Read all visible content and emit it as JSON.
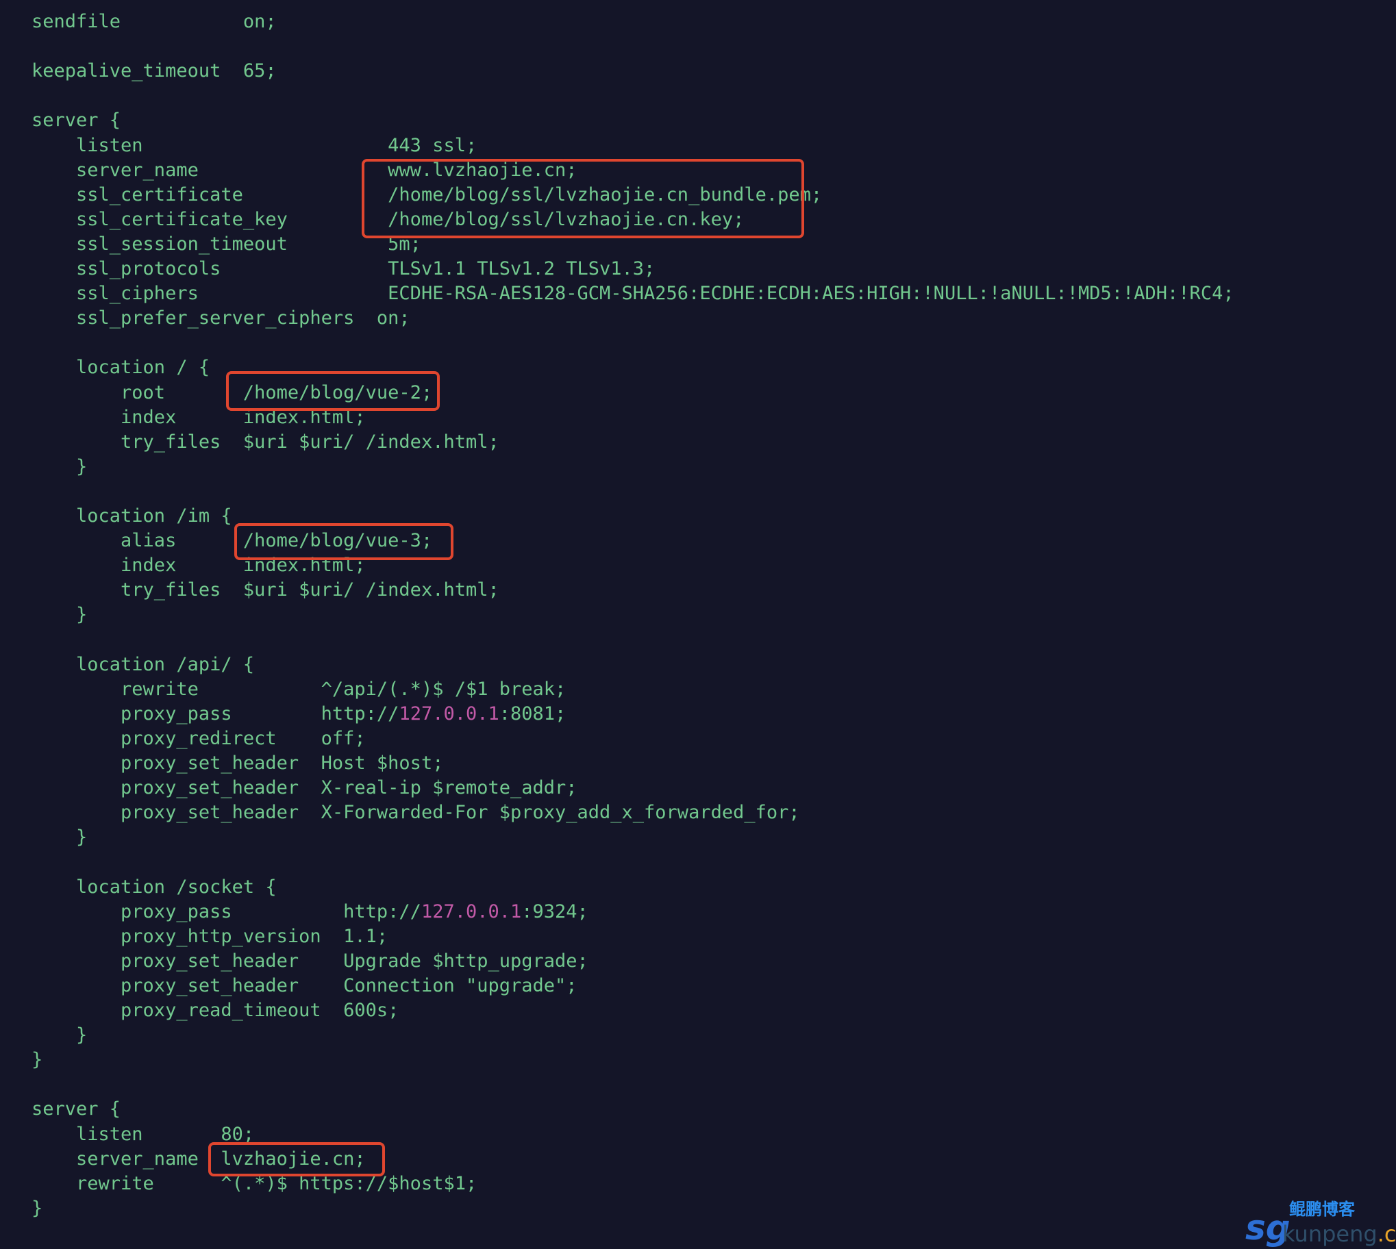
{
  "code": {
    "lines": [
      "sendfile           on;",
      "",
      "keepalive_timeout  65;",
      "",
      "server {",
      "    listen                      443 ssl;",
      "    server_name                 www.lvzhaojie.cn;",
      "    ssl_certificate             /home/blog/ssl/lvzhaojie.cn_bundle.pem;",
      "    ssl_certificate_key         /home/blog/ssl/lvzhaojie.cn.key;",
      "    ssl_session_timeout         5m;",
      "    ssl_protocols               TLSv1.1 TLSv1.2 TLSv1.3;",
      "    ssl_ciphers                 ECDHE-RSA-AES128-GCM-SHA256:ECDHE:ECDH:AES:HIGH:!NULL:!aNULL:!MD5:!ADH:!RC4;",
      "    ssl_prefer_server_ciphers  on;",
      "",
      "    location / {",
      "        root       /home/blog/vue-2;",
      "        index      index.html;",
      "        try_files  $uri $uri/ /index.html;",
      "    }",
      "",
      "    location /im {",
      "        alias      /home/blog/vue-3;",
      "        index      index.html;",
      "        try_files  $uri $uri/ /index.html;",
      "    }",
      "",
      "    location /api/ {",
      "        rewrite           ^/api/(.*)$ /$1 break;",
      "        proxy_pass        http://",
      "        proxy_redirect    off;",
      "        proxy_set_header  Host $host;",
      "        proxy_set_header  X-real-ip $remote_addr;",
      "        proxy_set_header  X-Forwarded-For $proxy_add_x_forwarded_for;",
      "    }",
      "",
      "    location /socket {",
      "        proxy_pass          http://",
      "        proxy_http_version  1.1;",
      "        proxy_set_header    Upgrade $http_upgrade;",
      "        proxy_set_header    Connection \"upgrade\";",
      "        proxy_read_timeout  600s;",
      "    }",
      "}",
      "",
      "server {",
      "    listen       80;",
      "    server_name  lvzhaojie.cn;",
      "    rewrite      ^(.*)$ https://$host$1;",
      "}"
    ],
    "api_proxy": {
      "ip": "127.0.0.1",
      "port_suffix": ":8081;"
    },
    "socket_proxy": {
      "ip": "127.0.0.1",
      "port_suffix": ":9324;"
    }
  },
  "watermark": {
    "logo": "sg",
    "brand": "鲲鹏博客",
    "domain_main": "kunpeng",
    "domain_tld": ".cn"
  },
  "colors": {
    "background": "#141528",
    "code_text": "#72c88e",
    "ip_literal": "#c25aa7",
    "highlight_box": "#e0462f"
  }
}
